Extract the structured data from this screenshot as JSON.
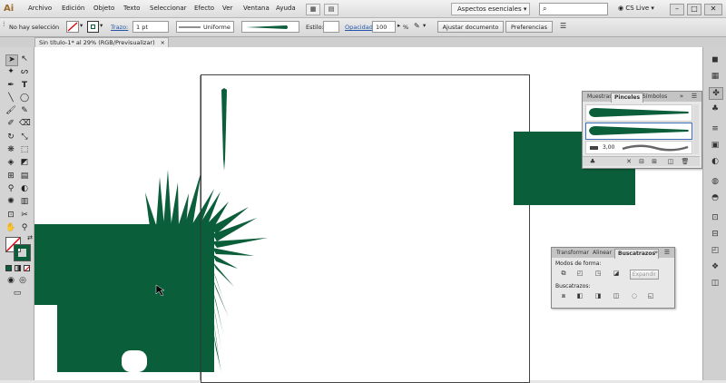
{
  "app": {
    "logo": "Ai"
  },
  "menu": {
    "items": [
      "Archivo",
      "Edición",
      "Objeto",
      "Texto",
      "Seleccionar",
      "Efecto",
      "Ver",
      "Ventana",
      "Ayuda"
    ],
    "workspace": "Aspectos esenciales ▾",
    "search_placeholder": "",
    "cs_live": "CS Live ▾"
  },
  "control_bar": {
    "selection_label": "No hay selección",
    "stroke_label": "Trazo:",
    "stroke_weight": "1 pt",
    "stroke_profile": "Uniforme",
    "style_label": "Estilo:",
    "opacity_label": "Opacidad:",
    "opacity_value": "100",
    "opacity_unit": "%",
    "doc_setup_button": "Ajustar documento",
    "preferences_button": "Preferencias"
  },
  "document": {
    "tab_title": "Sin título-1* al 29% (RGB/Previsualizar)",
    "tab_close": "×"
  },
  "brushes_panel": {
    "tabs": [
      "Muestras",
      "Pinceles",
      "Símbolos"
    ],
    "active_tab": 1,
    "brush_size": "3,00"
  },
  "pathfinder_panel": {
    "tabs": [
      "Transformar",
      "Alinear",
      "Buscatrazos"
    ],
    "active_tab": 2,
    "shape_modes_label": "Modos de forma:",
    "expand_button": "Expandir",
    "pathfinders_label": "Buscatrazos:"
  },
  "colors": {
    "brush_green": "#0b5e3a",
    "artboard_border": "#444444"
  }
}
